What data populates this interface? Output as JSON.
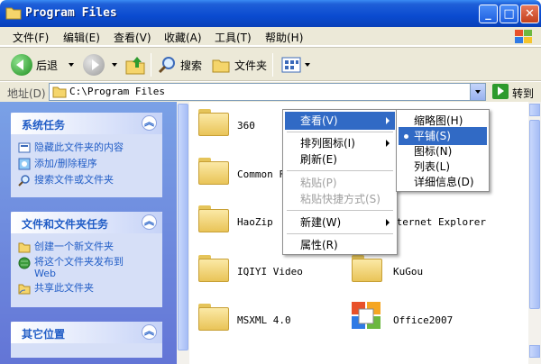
{
  "window": {
    "title": "Program Files",
    "controls": {
      "minimize": "_",
      "maximize": "□",
      "close": "✕"
    }
  },
  "menubar": [
    "文件(F)",
    "编辑(E)",
    "查看(V)",
    "收藏(A)",
    "工具(T)",
    "帮助(H)"
  ],
  "toolbar": {
    "back": "后退",
    "search": "搜索",
    "folders": "文件夹"
  },
  "address": {
    "label": "地址(D)",
    "value": "C:\\Program Files",
    "go": "转到"
  },
  "panels": [
    {
      "title": "系统任务",
      "links": [
        "隐藏此文件夹的内容",
        "添加/删除程序",
        "搜索文件或文件夹"
      ]
    },
    {
      "title": "文件和文件夹任务",
      "links": [
        "创建一个新文件夹",
        "将这个文件夹发布到\nWeb",
        "共享此文件夹"
      ]
    },
    {
      "title": "其它位置",
      "links": []
    }
  ],
  "files": [
    {
      "name": "360",
      "icon": "folder"
    },
    {
      "name": "Common F",
      "icon": "folder"
    },
    {
      "name": "HaoZip",
      "icon": "folder"
    },
    {
      "name": "nternet Explorer",
      "icon": "folder"
    },
    {
      "name": "IQIYI Video",
      "icon": "folder"
    },
    {
      "name": "KuGou",
      "icon": "folder"
    },
    {
      "name": "MSXML 4.0",
      "icon": "folder"
    },
    {
      "name": "Office2007",
      "icon": "office-logo"
    }
  ],
  "context_menu": [
    {
      "label": "查看(V)",
      "submenu": true,
      "active": true
    },
    {
      "label": "排列图标(I)",
      "submenu": true
    },
    {
      "label": "刷新(E)"
    },
    {
      "label": "粘贴(P)",
      "disabled": true
    },
    {
      "label": "粘贴快捷方式(S)",
      "disabled": true
    },
    {
      "label": "新建(W)",
      "submenu": true
    },
    {
      "label": "属性(R)"
    }
  ],
  "submenu": [
    {
      "label": "缩略图(H)"
    },
    {
      "label": "平铺(S)",
      "selected": true
    },
    {
      "label": "图标(N)"
    },
    {
      "label": "列表(L)"
    },
    {
      "label": "详细信息(D)"
    }
  ]
}
